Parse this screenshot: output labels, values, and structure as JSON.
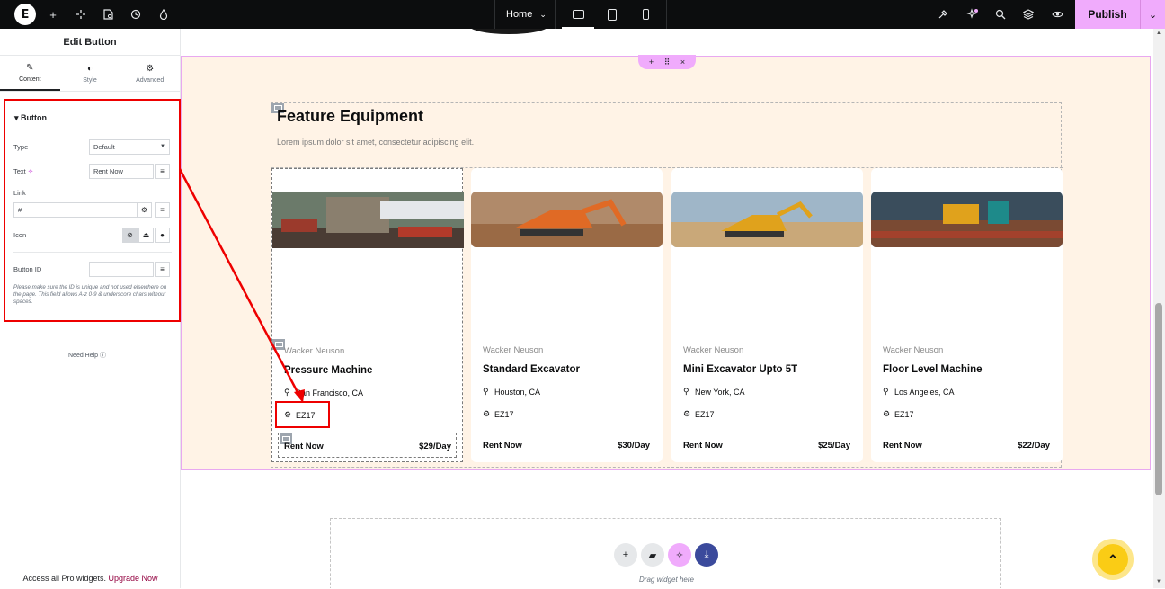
{
  "topbar": {
    "logo": "E",
    "page_selector": "Home",
    "publish": "Publish",
    "icons": [
      "add-icon",
      "site-settings-icon",
      "page-settings-icon",
      "history-icon",
      "color-theme-icon"
    ],
    "devices": [
      "desktop-icon",
      "tablet-icon",
      "mobile-icon"
    ],
    "right_icons": [
      "tools-icon",
      "ai-notifications-icon",
      "search-icon",
      "structure-icon",
      "preview-icon"
    ]
  },
  "panel": {
    "title": "Edit Button",
    "tabs": [
      {
        "label": "Content",
        "icon": "pencil-icon"
      },
      {
        "label": "Style",
        "icon": "half-circle-icon"
      },
      {
        "label": "Advanced",
        "icon": "gear-icon"
      }
    ],
    "section": "Button",
    "type_label": "Type",
    "type_value": "Default",
    "text_label": "Text",
    "text_value": "Rent Now",
    "link_label": "Link",
    "link_value": "#",
    "icon_label": "Icon",
    "button_id_label": "Button ID",
    "button_id_value": "",
    "note": "Please make sure the ID is unique and not used elsewhere on the page. This field allows A-z 0-9 & underscore chars without spaces.",
    "need_help": "Need Help",
    "promo_text": "Access all Pro widgets.",
    "promo_link": "Upgrade Now"
  },
  "canvas": {
    "heading": "Feature Equipment",
    "subheading": "Lorem ipsum dolor sit amet, consectetur adipiscing elit.",
    "cards": [
      {
        "brand": "Wacker Neuson",
        "title": "Pressure Machine",
        "location": "San Francisco, CA",
        "model": "EZ17",
        "cta": "Rent Now",
        "price": "$29/Day"
      },
      {
        "brand": "Wacker Neuson",
        "title": "Standard Excavator",
        "location": "Houston, CA",
        "model": "EZ17",
        "cta": "Rent Now",
        "price": "$30/Day"
      },
      {
        "brand": "Wacker Neuson",
        "title": "Mini Excavator Upto 5T",
        "location": "New York, CA",
        "model": "EZ17",
        "cta": "Rent Now",
        "price": "$25/Day"
      },
      {
        "brand": "Wacker Neuson",
        "title": "Floor Level Machine",
        "location": "Los Angeles, CA",
        "model": "EZ17",
        "cta": "Rent Now",
        "price": "$22/Day"
      }
    ],
    "drop_hint": "Drag widget here"
  },
  "colors": {
    "accent": "#f0abfc",
    "annotation": "#ee0000",
    "section_bg": "#fff3e6",
    "fab": "#facc15"
  }
}
